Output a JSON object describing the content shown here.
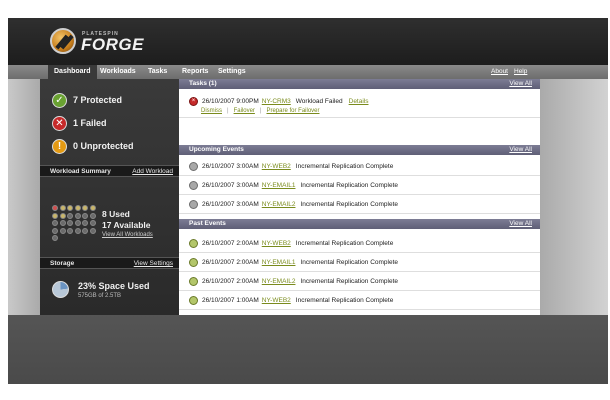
{
  "brand": {
    "small": "PLATESPIN",
    "big": "FORGE"
  },
  "nav": {
    "tabs": [
      {
        "label": "Dashboard",
        "active": true
      },
      {
        "label": "Workloads"
      },
      {
        "label": "Tasks"
      },
      {
        "label": "Reports"
      },
      {
        "label": "Settings"
      }
    ],
    "about": "About",
    "help": "Help"
  },
  "sidebar": {
    "protected": "7 Protected",
    "failed": "1 Failed",
    "unprotected": "0 Unprotected",
    "workload_summary": {
      "title": "Workload Summary",
      "add_link": "Add Workload",
      "used": "8 Used",
      "available": "17 Available",
      "view_all": "View All Workloads"
    },
    "storage": {
      "title": "Storage",
      "settings_link": "View Settings",
      "space_used": "23% Space Used",
      "detail": "575GB of 2.5TB",
      "fraction_used": 0.23
    }
  },
  "tasks": {
    "title": "Tasks (1)",
    "view_all": "View All",
    "items": [
      {
        "date": "26/10/2007 9:00PM",
        "workload": "NY-CRM3",
        "message": "Workload Failed",
        "details": "Details",
        "actions": [
          "Dismiss",
          "Failover",
          "Prepare for Failover"
        ]
      }
    ]
  },
  "upcoming": {
    "title": "Upcoming Events",
    "view_all": "View All",
    "items": [
      {
        "date": "26/10/2007 3:00AM",
        "workload": "NY-WEB2",
        "message": "Incremental Replication Complete"
      },
      {
        "date": "26/10/2007 3:00AM",
        "workload": "NY-EMAIL1",
        "message": "Incremental Replication Complete"
      },
      {
        "date": "26/10/2007 3:00AM",
        "workload": "NY-EMAIL2",
        "message": "Incremental Replication Complete"
      }
    ]
  },
  "past": {
    "title": "Past Events",
    "view_all": "View All",
    "items": [
      {
        "date": "26/10/2007 2:00AM",
        "workload": "NY-WEB2",
        "message": "Incremental Replication Complete"
      },
      {
        "date": "26/10/2007 2:00AM",
        "workload": "NY-EMAIL1",
        "message": "Incremental Replication Complete"
      },
      {
        "date": "26/10/2007 2:00AM",
        "workload": "NY-EMAIL2",
        "message": "Incremental Replication Complete"
      },
      {
        "date": "26/10/2007 1:00AM",
        "workload": "NY-WEB2",
        "message": "Incremental Replication Complete"
      }
    ]
  },
  "icons": {
    "protected": "check-circle-icon",
    "failed": "x-circle-icon",
    "unprotected": "exclamation-circle-icon",
    "event": "event-circle-icon",
    "storage": "pie-icon"
  },
  "colors": {
    "accent_link": "#7a8b1c",
    "section_bar": "#6b6b84",
    "ok": "#6aa232",
    "fail": "#c62a2a",
    "warn": "#e49a13"
  }
}
